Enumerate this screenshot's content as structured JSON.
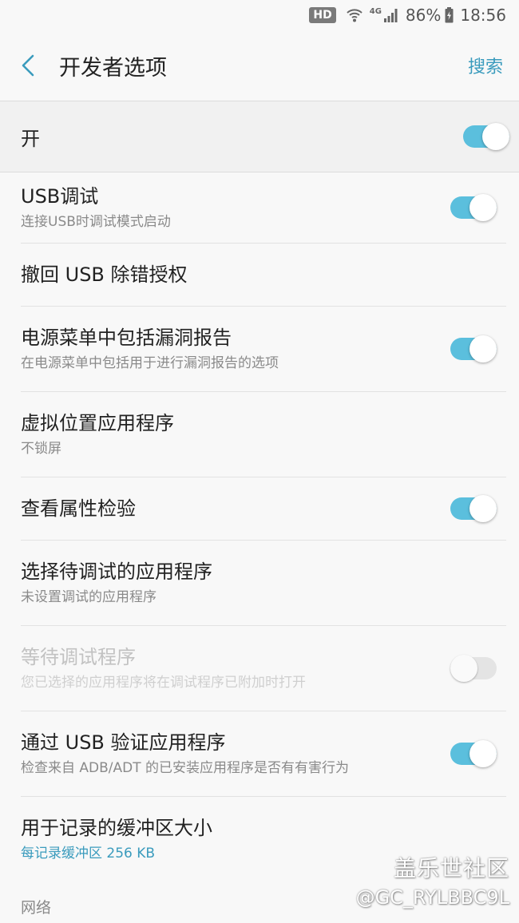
{
  "status_bar": {
    "hd": "HD",
    "network": "4G",
    "battery": "86%",
    "time": "18:56"
  },
  "app_bar": {
    "title": "开发者选项",
    "search_label": "搜索",
    "accent_color": "#3a9bbd"
  },
  "master": {
    "label": "开",
    "enabled": true
  },
  "items": [
    {
      "title": "USB调试",
      "summary": "连接USB时调试模式启动",
      "toggle": true
    },
    {
      "title": "撤回 USB 除错授权"
    },
    {
      "title": "电源菜单中包括漏洞报告",
      "summary": "在电源菜单中包括用于进行漏洞报告的选项",
      "toggle": true
    },
    {
      "title": "虚拟位置应用程序",
      "summary": "不锁屏"
    },
    {
      "title": "查看属性检验",
      "toggle": true
    },
    {
      "title": "选择待调试的应用程序",
      "summary": "未设置调试的应用程序"
    },
    {
      "title": "等待调试程序",
      "summary": "您已选择的应用程序将在调试程序已附加时打开",
      "toggle": false,
      "disabled": true
    },
    {
      "title": "通过 USB 验证应用程序",
      "summary": "检查来自 ADB/ADT 的已安装应用程序是否有有害行为",
      "toggle": true
    },
    {
      "title": "用于记录的缓冲区大小",
      "summary": "每记录缓冲区 256 KB"
    }
  ],
  "section": {
    "network_header": "网络"
  },
  "watermark": {
    "line1": "盖乐世社区",
    "line2": "@GC_RYLBBC9L"
  }
}
